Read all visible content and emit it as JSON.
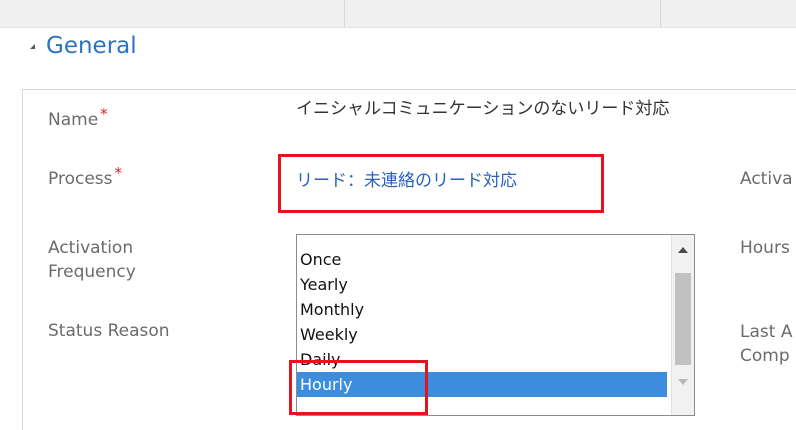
{
  "section": {
    "title": "General"
  },
  "fields": {
    "name": {
      "label": "Name",
      "required_mark": "*",
      "value": "イニシャルコミュニケーションのないリード対応"
    },
    "process": {
      "label": "Process",
      "required_mark": "*",
      "value": "リード：未連絡のリード対応"
    },
    "activation_frequency": {
      "label_line1": "Activation",
      "label_line2": "Frequency"
    },
    "status_reason": {
      "label": "Status Reason"
    }
  },
  "frequency_options": [
    "Once",
    "Yearly",
    "Monthly",
    "Weekly",
    "Daily",
    "Hourly"
  ],
  "selected_option": "Hourly",
  "right_column": {
    "activation_cut": "Activa",
    "hours_cut": "Hours",
    "last_cut": "Last A",
    "completed_cut": "Comp"
  },
  "colors": {
    "accent": "#2a73c4",
    "highlight_box": "#e3141c",
    "selection": "#3c8dde",
    "required": "#d4241f"
  }
}
